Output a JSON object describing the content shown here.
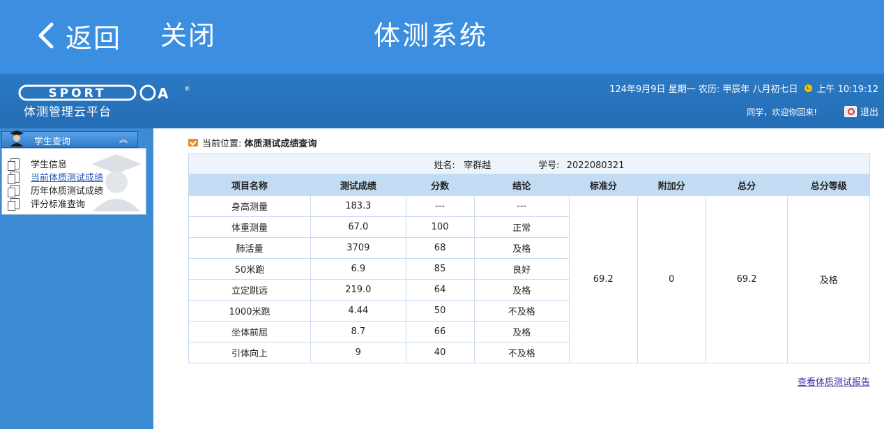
{
  "appbar": {
    "back_label": "返回",
    "close_label": "关闭",
    "title": "体测系统"
  },
  "header": {
    "logo_text": "SPORTOA",
    "platform_name": "体测管理云平台",
    "date": "124年9月9日 星期一 农历: 甲辰年 八月初七日",
    "time": "上午 10:19:12",
    "welcome": "同学，欢迎你回来!",
    "logout_label": "退出"
  },
  "sidebar": {
    "section_label": "学生查询",
    "items": [
      {
        "label": "学生信息"
      },
      {
        "label": "当前体质测试成绩"
      },
      {
        "label": "历年体质测试成绩"
      },
      {
        "label": "评分标准查询"
      }
    ]
  },
  "breadcrumb": {
    "prefix": "当前位置:",
    "current": "体质测试成绩查询"
  },
  "student": {
    "name_label": "姓名:",
    "name": "宰群越",
    "id_label": "学号:",
    "id": "2022080321"
  },
  "table": {
    "headers": [
      "项目名称",
      "测试成绩",
      "分数",
      "结论",
      "标准分",
      "附加分",
      "总分",
      "总分等级"
    ],
    "rows": [
      [
        "身高测量",
        "183.3",
        "---",
        "---"
      ],
      [
        "体重测量",
        "67.0",
        "100",
        "正常"
      ],
      [
        "肺活量",
        "3709",
        "68",
        "及格"
      ],
      [
        "50米跑",
        "6.9",
        "85",
        "良好"
      ],
      [
        "立定跳远",
        "219.0",
        "64",
        "及格"
      ],
      [
        "1000米跑",
        "4.44",
        "50",
        "不及格"
      ],
      [
        "坐体前屈",
        "8.7",
        "66",
        "及格"
      ],
      [
        "引体向上",
        "9",
        "40",
        "不及格"
      ]
    ],
    "summary": {
      "standard_score": "69.2",
      "bonus": "0",
      "total": "69.2",
      "grade": "及格"
    }
  },
  "report_link": "查看体质测试报告",
  "colors": {
    "appbar": "#3c8fe0",
    "header": "#2b79c4",
    "sidebar": "#3a8ad4",
    "table_header": "#c4dcf3"
  }
}
